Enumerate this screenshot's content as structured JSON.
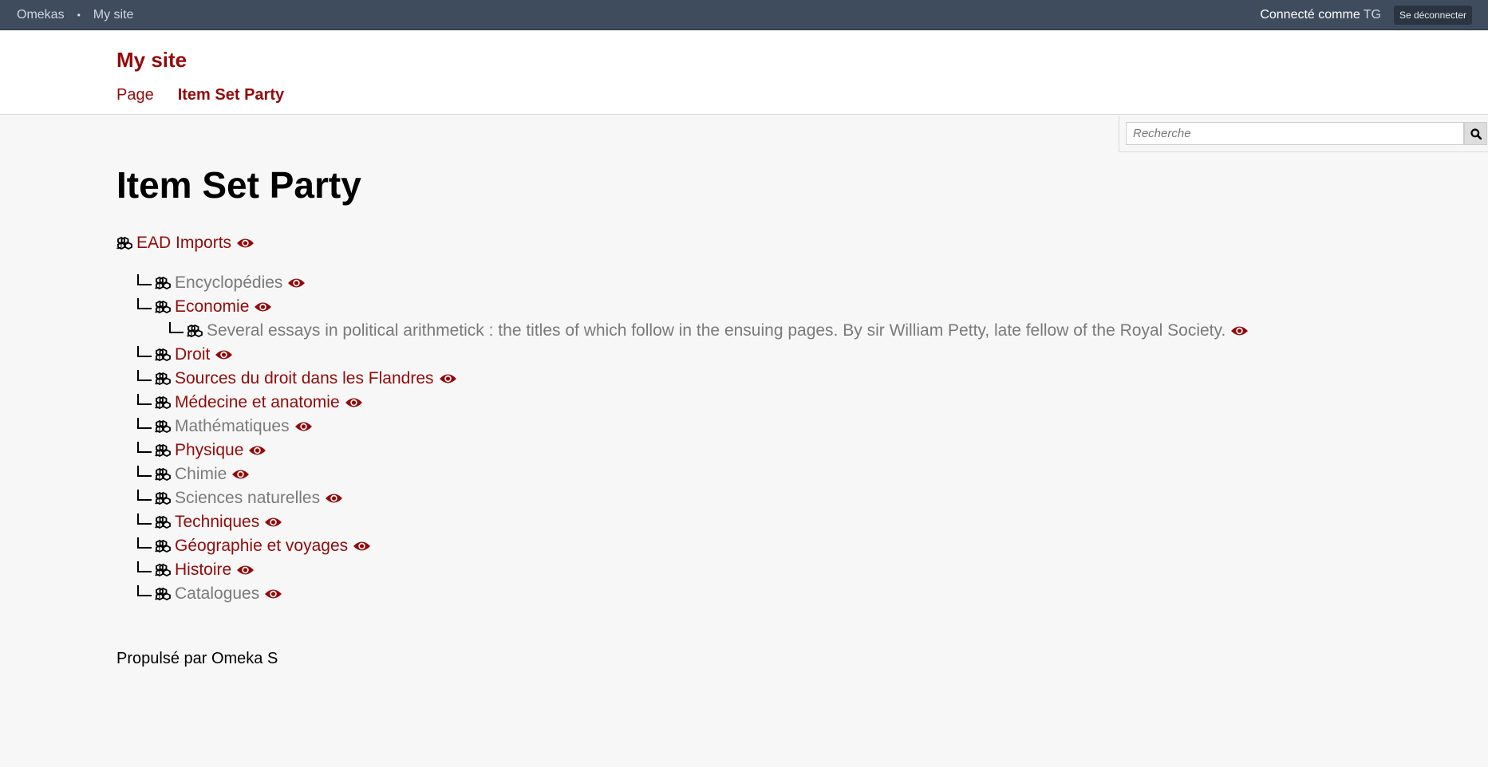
{
  "admin_bar": {
    "home_link": "Omekas",
    "separator": "•",
    "site_link": "My site",
    "logged_in_label": "Connecté comme",
    "user": "TG",
    "logout_label": "Se déconnecter"
  },
  "header": {
    "site_title": "My site",
    "nav": [
      "Page",
      "Item Set Party"
    ]
  },
  "search": {
    "placeholder": "Recherche"
  },
  "main": {
    "title": "Item Set Party",
    "root": {
      "label": "EAD Imports",
      "public": true
    },
    "children": [
      {
        "label": "Encyclopédies",
        "public": false
      },
      {
        "label": "Economie",
        "public": true
      },
      {
        "label": "Several essays in political arithmetick : the titles of which follow in the ensuing pages. By sir William Petty, late fellow of the Royal Society.",
        "public": false,
        "level": 2
      },
      {
        "label": "Droit",
        "public": true
      },
      {
        "label": "Sources du droit dans les Flandres",
        "public": true
      },
      {
        "label": "Médecine et anatomie",
        "public": true
      },
      {
        "label": "Mathématiques",
        "public": false
      },
      {
        "label": "Physique",
        "public": true
      },
      {
        "label": "Chimie",
        "public": false
      },
      {
        "label": "Sciences naturelles",
        "public": false
      },
      {
        "label": "Techniques",
        "public": true
      },
      {
        "label": "Géographie et voyages",
        "public": true
      },
      {
        "label": "Histoire",
        "public": true
      },
      {
        "label": "Catalogues",
        "public": false
      }
    ]
  },
  "footer": {
    "text": "Propulsé par Omeka S"
  },
  "colors": {
    "accent": "#920b0b",
    "muted": "#7a7a7a",
    "admin_bar": "#3f4c5e"
  },
  "icons": {
    "set": "item-set-icon",
    "visibility": "eye-icon",
    "search": "search-icon"
  }
}
